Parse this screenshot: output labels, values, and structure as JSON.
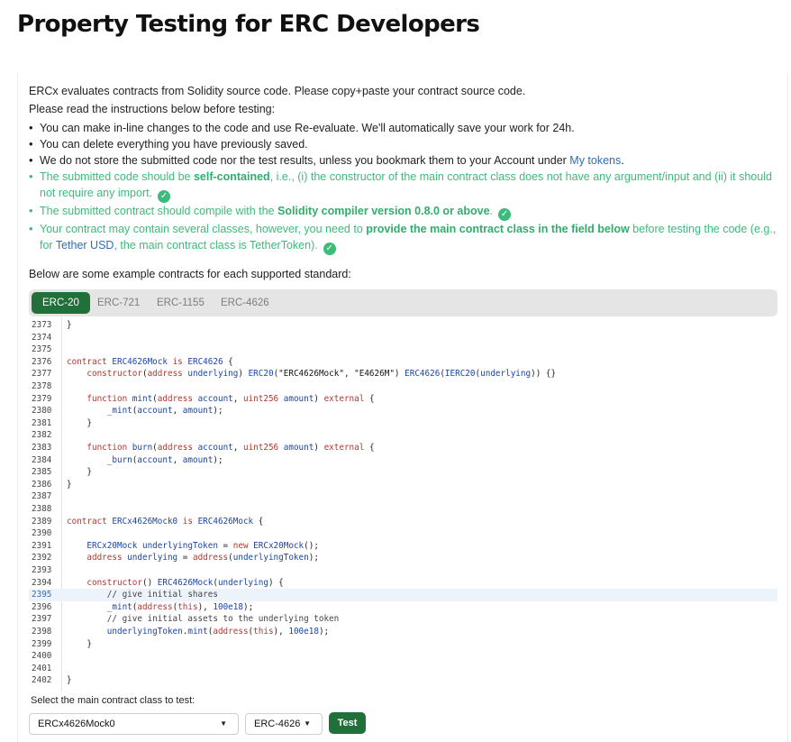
{
  "page_title": "Property Testing for ERC Developers",
  "intro": {
    "p1": "ERCx evaluates contracts from Solidity source code. Please copy+paste your contract source code.",
    "p2": "Please read the instructions below before testing:",
    "b1": "You can make in-line changes to the code and use Re-evaluate. We'll automatically save your work for 24h.",
    "b2": "You can delete everything you have previously saved.",
    "b3_pre": "We do not store the submitted code nor the test results, unless you bookmark them to your Account under ",
    "b3_link": "My tokens",
    "b3_post": ".",
    "b4_pre": "The submitted code should be ",
    "b4_bold": "self-contained",
    "b4_post": ", i.e., (i) the constructor of the main contract class does not have any argument/input and (ii) it should not require any import.",
    "b5_pre": "The submitted contract should compile with the ",
    "b5_bold": "Solidity compiler version 0.8.0 or above",
    "b5_post": ".",
    "b6_pre": "Your contract may contain several classes, however, you need to ",
    "b6_bold": "provide the main contract class in the field below",
    "b6_mid": " before testing the code (e.g., for ",
    "b6_link": "Tether USD",
    "b6_post": ", the main contract class is TetherToken).",
    "check_icon": "✓"
  },
  "examples_label": "Below are some example contracts for each supported standard:",
  "tabs": [
    "ERC-20",
    "ERC-721",
    "ERC-1155",
    "ERC-4626"
  ],
  "active_tab": "ERC-20",
  "code": {
    "highlighted_line": "2395",
    "lines": [
      {
        "n": "2373",
        "t": "}"
      },
      {
        "n": "2374",
        "t": ""
      },
      {
        "n": "2375",
        "t": ""
      },
      {
        "n": "2376",
        "t": "contract ERC4626Mock is ERC4626 {"
      },
      {
        "n": "2377",
        "t": "    constructor(address underlying) ERC20(\"ERC4626Mock\", \"E4626M\") ERC4626(IERC20(underlying)) {}"
      },
      {
        "n": "2378",
        "t": ""
      },
      {
        "n": "2379",
        "t": "    function mint(address account, uint256 amount) external {"
      },
      {
        "n": "2380",
        "t": "        _mint(account, amount);"
      },
      {
        "n": "2381",
        "t": "    }"
      },
      {
        "n": "2382",
        "t": ""
      },
      {
        "n": "2383",
        "t": "    function burn(address account, uint256 amount) external {"
      },
      {
        "n": "2384",
        "t": "        _burn(account, amount);"
      },
      {
        "n": "2385",
        "t": "    }"
      },
      {
        "n": "2386",
        "t": "}"
      },
      {
        "n": "2387",
        "t": ""
      },
      {
        "n": "2388",
        "t": ""
      },
      {
        "n": "2389",
        "t": "contract ERCx4626Mock0 is ERC4626Mock {"
      },
      {
        "n": "2390",
        "t": ""
      },
      {
        "n": "2391",
        "t": "    ERCx20Mock underlyingToken = new ERCx20Mock();"
      },
      {
        "n": "2392",
        "t": "    address underlying = address(underlyingToken);"
      },
      {
        "n": "2393",
        "t": ""
      },
      {
        "n": "2394",
        "t": "    constructor() ERC4626Mock(underlying) {"
      },
      {
        "n": "2395",
        "t": "        // give initial shares"
      },
      {
        "n": "2396",
        "t": "        _mint(address(this), 100e18);"
      },
      {
        "n": "2397",
        "t": "        // give initial assets to the underlying token"
      },
      {
        "n": "2398",
        "t": "        underlyingToken.mint(address(this), 100e18);"
      },
      {
        "n": "2399",
        "t": "    }"
      },
      {
        "n": "2400",
        "t": ""
      },
      {
        "n": "2401",
        "t": ""
      },
      {
        "n": "2402",
        "t": "}"
      }
    ]
  },
  "select_label": "Select the main contract class to test:",
  "class_select": {
    "value": "ERCx4626Mock0",
    "icon": "caret-down-icon"
  },
  "standard_select": {
    "value": "ERC-4626",
    "icon": "caret-down-icon"
  },
  "test_button": "Test",
  "colors": {
    "accent": "#21703a",
    "ok": "#3dbb7a",
    "link": "#2f6db5"
  }
}
